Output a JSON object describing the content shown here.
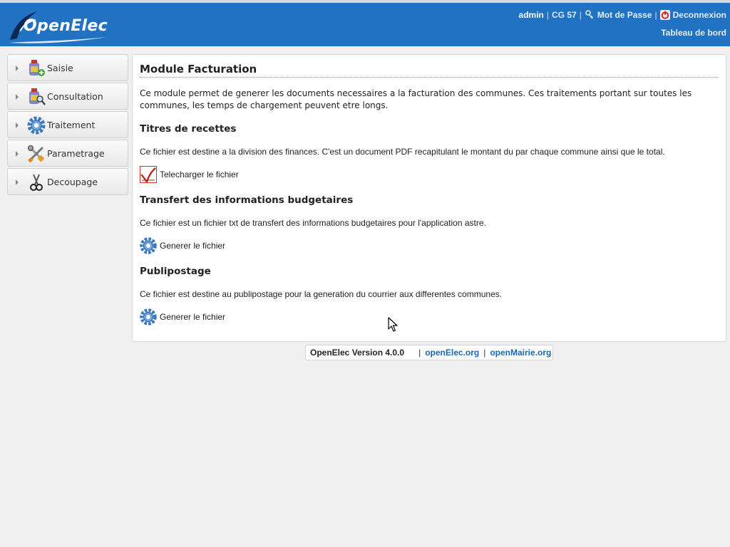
{
  "header": {
    "logo_text": "OpenElec",
    "user": "admin",
    "collectivite": "CG 57",
    "password_label": "Mot de Passe",
    "logout_label": "Deconnexion",
    "dashboard_label": "Tableau de bord",
    "separator": "|",
    "icons": [
      "key-icon",
      "power-icon"
    ]
  },
  "sidebar": {
    "items": [
      {
        "label": "Saisie",
        "icon": "bottle-add-icon"
      },
      {
        "label": "Consultation",
        "icon": "bottle-search-icon"
      },
      {
        "label": "Traitement",
        "icon": "gear-icon"
      },
      {
        "label": "Parametrage",
        "icon": "tools-icon"
      },
      {
        "label": "Decoupage",
        "icon": "scissors-icon"
      }
    ]
  },
  "main": {
    "title": "Module Facturation",
    "intro": "Ce module permet de generer les documents necessaires a la facturation des communes. Ces traitements portant sur toutes les communes, les temps de chargement peuvent etre longs.",
    "sections": [
      {
        "title": "Titres de recettes",
        "description": "Ce fichier est destine a la division des finances. C'est un document PDF recapitulant le montant du par chaque commune ainsi que le total.",
        "action_label": "Telecharger le fichier",
        "action_icon": "pdf-icon"
      },
      {
        "title": "Transfert des informations budgetaires",
        "description": "Ce fichier est un fichier txt de transfert des informations budgetaires pour l'application astre.",
        "action_label": "Generer le fichier",
        "action_icon": "gear-icon"
      },
      {
        "title": "Publipostage",
        "description": "Ce fichier est destine au publipostage pour la generation du courrier aux differentes communes.",
        "action_label": "Generer le fichier",
        "action_icon": "gear-icon"
      }
    ]
  },
  "footer": {
    "version": "OpenElec Version 4.0.0",
    "separator": "|",
    "link1": "openElec.org",
    "link2": "openMairie.org"
  },
  "colors": {
    "header_bg": "#2272c4",
    "link": "#1a66b8",
    "page_bg": "#f0f0f0"
  }
}
